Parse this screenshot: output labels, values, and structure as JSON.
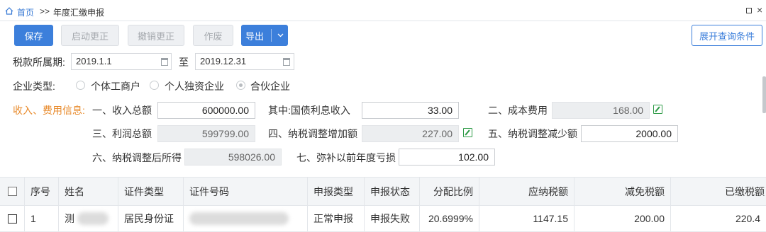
{
  "breadcrumb": {
    "home": "首页",
    "sep": ">>",
    "page": "年度汇缴申报"
  },
  "window": {
    "restore_icon": "restore-icon",
    "close_glyph": "×"
  },
  "toolbar": {
    "save": "保存",
    "start_correction": "启动更正",
    "cancel_correction": "撤销更正",
    "void": "作废",
    "export": "导出",
    "expand_query": "展开查询条件"
  },
  "period": {
    "label": "税款所属期:",
    "from": "2019.1.1",
    "to_label": "至",
    "to": "2019.12.31"
  },
  "enterprise": {
    "label": "企业类型:",
    "options": [
      "个体工商户",
      "个人独资企业",
      "合伙企业"
    ],
    "selected": "合伙企业"
  },
  "income": {
    "section_label": "收入、费用信息:",
    "total_income_label": "一、收入总额",
    "total_income": "600000.00",
    "bond_interest_label": "其中:国债利息收入",
    "bond_interest": "33.00",
    "cost_label": "二、成本费用",
    "cost": "168.00",
    "profit_label": "三、利润总额",
    "profit": "599799.00",
    "adjust_increase_label": "四、纳税调整增加额",
    "adjust_increase": "227.00",
    "adjust_decrease_label": "五、纳税调整减少额",
    "adjust_decrease": "2000.00",
    "adjusted_income_label": "六、纳税调整后所得",
    "adjusted_income": "598026.00",
    "loss_cover_label": "七、弥补以前年度亏损",
    "loss_cover": "102.00"
  },
  "table": {
    "headers": [
      "序号",
      "姓名",
      "证件类型",
      "证件号码",
      "申报类型",
      "申报状态",
      "分配比例",
      "应纳税额",
      "减免税额",
      "已缴税额"
    ],
    "rows": [
      {
        "index": "1",
        "name": "测",
        "id_type": "居民身份证",
        "id_number": "",
        "declare_type": "正常申报",
        "status": "申报失败",
        "ratio": "20.6999%",
        "tax_payable": "1147.15",
        "tax_reduction": "200.00",
        "tax_paid": "220.4"
      }
    ]
  },
  "colors": {
    "primary": "#3c7fdb",
    "orange": "#e88a2b",
    "edit_green": "#2e9b47"
  }
}
